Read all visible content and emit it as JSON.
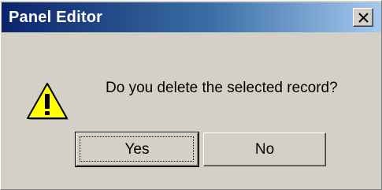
{
  "window": {
    "title": "Panel Editor",
    "close_icon": "close-icon"
  },
  "dialog": {
    "icon": "warning-icon",
    "message": "Do you delete the selected record?",
    "buttons": {
      "yes_label": "Yes",
      "no_label": "No"
    }
  },
  "colors": {
    "title_gradient_start": "#0a246a",
    "title_gradient_end": "#a6caf0",
    "dialog_background": "#d4d0c8",
    "warning_yellow": "#ffff00"
  }
}
